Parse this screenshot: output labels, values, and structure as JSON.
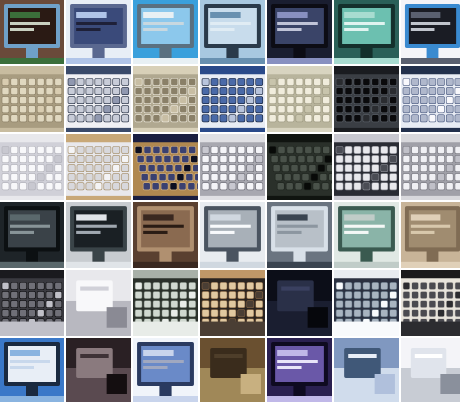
{
  "grid": {
    "rows": 6,
    "cols": 7,
    "tiles": [
      {
        "subject": "monitor-map",
        "colors": [
          "#6a4a3a",
          "#2a1a14",
          "#3b6e3a",
          "#6fa0c8",
          "#c8d0c0"
        ]
      },
      {
        "subject": "monitor-bright",
        "colors": [
          "#e8eef6",
          "#3a4a7a",
          "#b0c4e8",
          "#5a6890",
          "#1e2038"
        ]
      },
      {
        "subject": "monitor-landscape",
        "colors": [
          "#3aa0dc",
          "#8cc8ec",
          "#e8f0f4",
          "#5a7080",
          "#c8d8e0"
        ]
      },
      {
        "subject": "monitor-window",
        "colors": [
          "#a8c8e0",
          "#c8dcec",
          "#6890b0",
          "#2a3a4a",
          "#e0ecf4"
        ]
      },
      {
        "subject": "monitor-dark-app",
        "colors": [
          "#1a1e30",
          "#3a4468",
          "#8890c0",
          "#0c0c14",
          "#c0c4d8"
        ]
      },
      {
        "subject": "monitor-teal",
        "colors": [
          "#2a6058",
          "#6cc0b0",
          "#a8dcd0",
          "#14302c",
          "#e0f4f0"
        ]
      },
      {
        "subject": "monitor-stand",
        "colors": [
          "#f4f4f8",
          "#1a1c24",
          "#5a6070",
          "#3a8ad0",
          "#c0c4cc"
        ]
      },
      {
        "subject": "keyboard-beige",
        "colors": [
          "#c8bca0",
          "#a89c80",
          "#e0d8c0",
          "#8a7e64",
          "#d8ccb0"
        ]
      },
      {
        "subject": "keyboard-white-blue",
        "colors": [
          "#3a4a6a",
          "#f0f0f4",
          "#c8ccd8",
          "#1a2438",
          "#9098b0"
        ]
      },
      {
        "subject": "keyboard-beige-2",
        "colors": [
          "#d8d0b8",
          "#b0a890",
          "#8a8068",
          "#f0ece0",
          "#c8bea4"
        ]
      },
      {
        "subject": "keyboard-blue",
        "colors": [
          "#2a4a8a",
          "#e8ecf4",
          "#4a6aa8",
          "#101c34",
          "#b8c4dc"
        ]
      },
      {
        "subject": "keyboard-cream",
        "colors": [
          "#d8d4c0",
          "#b8b49c",
          "#f0ecdc",
          "#9c9880",
          "#c8c4ac"
        ]
      },
      {
        "subject": "keyboard-black",
        "colors": [
          "#1a1c20",
          "#3a3e44",
          "#0a0a0c",
          "#5a6068",
          "#2a2c30"
        ]
      },
      {
        "subject": "keyboard-white-navy",
        "colors": [
          "#22304c",
          "#e8ecf4",
          "#b0b8cc",
          "#4a5a80",
          "#f8f8fc"
        ]
      },
      {
        "subject": "keyboard-white-slim",
        "colors": [
          "#e8e8ec",
          "#d0d0d8",
          "#f8f8fa",
          "#b0b0b8",
          "#c8c8d0"
        ]
      },
      {
        "subject": "keyboard-white-wood",
        "colors": [
          "#c8a878",
          "#e8e8ec",
          "#d8d8dc",
          "#a08860",
          "#f4f4f6"
        ]
      },
      {
        "subject": "keyboard-navy-wood",
        "colors": [
          "#1a1e40",
          "#b08850",
          "#3a4070",
          "#d8b888",
          "#0c0e20"
        ]
      },
      {
        "subject": "keyboard-white-silver",
        "colors": [
          "#e0e0e4",
          "#a8a8b0",
          "#f4f4f8",
          "#6a6a74",
          "#c8c8d0"
        ]
      },
      {
        "subject": "keyboard-black-angle",
        "colors": [
          "#101410",
          "#2a302a",
          "#4a524a",
          "#1e241e",
          "#080a08"
        ]
      },
      {
        "subject": "keyboard-silver-dark",
        "colors": [
          "#c8c8d0",
          "#2a2c34",
          "#e8e8ec",
          "#8a8c94",
          "#4a4c54"
        ]
      },
      {
        "subject": "keyboard-white-gray",
        "colors": [
          "#d8d8dc",
          "#a0a0a8",
          "#f0f0f4",
          "#787880",
          "#c0c0c8"
        ]
      },
      {
        "subject": "monitor-dark-side",
        "colors": [
          "#1e2428",
          "#3a4248",
          "#5a686c",
          "#0c1012",
          "#889498"
        ]
      },
      {
        "subject": "monitor-silver-frame",
        "colors": [
          "#c8ccd0",
          "#1a2024",
          "#e0e4e8",
          "#3a4448",
          "#a0a8b0"
        ]
      },
      {
        "subject": "monitor-back-brown",
        "colors": [
          "#5a4030",
          "#8a6a50",
          "#3a2820",
          "#b09070",
          "#2a1c14"
        ]
      },
      {
        "subject": "monitor-white-desk",
        "colors": [
          "#e8ecf0",
          "#a8b0b8",
          "#d0d8e0",
          "#4a5460",
          "#f8fafc"
        ]
      },
      {
        "subject": "monitor-gray-gloss",
        "colors": [
          "#6a7480",
          "#b8c0c8",
          "#3a4450",
          "#d8e0e8",
          "#8c96a0"
        ]
      },
      {
        "subject": "monitor-crt-white",
        "colors": [
          "#e0e8e4",
          "#8ab4a8",
          "#c0ccc8",
          "#3a5a50",
          "#f4f8f6"
        ]
      },
      {
        "subject": "monitor-vent-beige",
        "colors": [
          "#c8b498",
          "#a08c70",
          "#e0d0b8",
          "#806c54",
          "#d8c8ac"
        ]
      },
      {
        "subject": "keyboard-black-desk",
        "colors": [
          "#1a1a1e",
          "#3a3a40",
          "#707078",
          "#0a0a0c",
          "#c0c0c8"
        ]
      },
      {
        "subject": "device-white-box",
        "colors": [
          "#e8e8ec",
          "#b8b8c0",
          "#f8f8fa",
          "#8a8a94",
          "#d0d0d8"
        ]
      },
      {
        "subject": "keyboard-desk-gray",
        "colors": [
          "#a8b0a8",
          "#2a302a",
          "#d0d8d0",
          "#5a645a",
          "#e8ece8"
        ]
      },
      {
        "subject": "keyboard-wood-desk",
        "colors": [
          "#c09868",
          "#2a2420",
          "#e0c8a0",
          "#806040",
          "#4a3e34"
        ]
      },
      {
        "subject": "scene-dark",
        "colors": [
          "#0c0e18",
          "#1a1e30",
          "#2a3048",
          "#06070c",
          "#3a4060"
        ]
      },
      {
        "subject": "keyboard-desk-papers",
        "colors": [
          "#e8ecf0",
          "#2a3040",
          "#a8b4c0",
          "#506070",
          "#f8fafc"
        ]
      },
      {
        "subject": "keyboard-papers-black",
        "colors": [
          "#1a1a1c",
          "#e8e4dc",
          "#4a4a50",
          "#d0ccc4",
          "#2c2c30"
        ]
      },
      {
        "subject": "monitor-blue-screen",
        "colors": [
          "#3a78c8",
          "#e8eef6",
          "#8ab4e0",
          "#1a2a40",
          "#c8d8ec"
        ]
      },
      {
        "subject": "speaker-dark",
        "colors": [
          "#2a2024",
          "#5a4a50",
          "#8a7a7e",
          "#140e10",
          "#3e3236"
        ]
      },
      {
        "subject": "monitor-white-screen",
        "colors": [
          "#f0f4fa",
          "#6a8ac8",
          "#c8d4ec",
          "#2a3a60",
          "#a0a8c0"
        ]
      },
      {
        "subject": "room-brown",
        "colors": [
          "#6a5030",
          "#a08858",
          "#3a2c1c",
          "#c8b080",
          "#4e3e2a"
        ]
      },
      {
        "subject": "tv-purple",
        "colors": [
          "#2a2050",
          "#6a58a8",
          "#c0b8e8",
          "#0e0a20",
          "#e8e4f8"
        ]
      },
      {
        "subject": "device-blue-gray",
        "colors": [
          "#8098c0",
          "#d0dcec",
          "#405878",
          "#b0c0dc",
          "#e8eef8"
        ]
      },
      {
        "subject": "window-bright",
        "colors": [
          "#f4f4f8",
          "#c8ccd4",
          "#e0e4ec",
          "#8a909c",
          "#ffffff"
        ]
      }
    ]
  }
}
